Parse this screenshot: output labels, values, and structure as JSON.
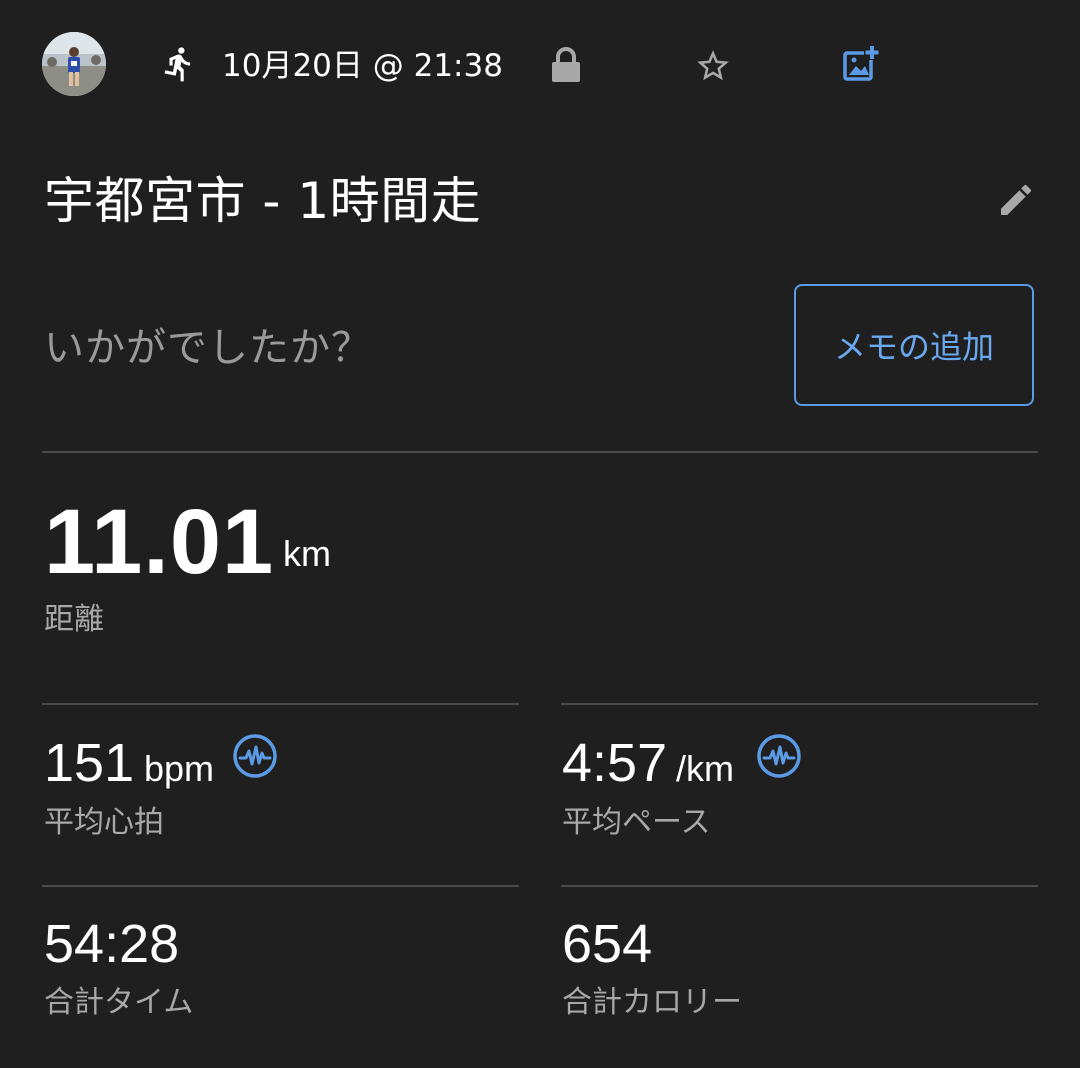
{
  "header": {
    "activity_icon": "running-icon",
    "datetime": "10月20日 @ 21:38",
    "privacy_icon": "lock-icon",
    "favorite_icon": "star-outline-icon",
    "add_photo_icon": "add-photo-icon"
  },
  "activity": {
    "title": "宇都宮市 - 1時間走",
    "edit_icon": "pencil-icon"
  },
  "note": {
    "prompt": "いかがでしたか？",
    "add_button_label": "メモの追加"
  },
  "distance": {
    "value": "11.01",
    "unit": "km",
    "label": "距離"
  },
  "stats": {
    "avg_heart_rate": {
      "value": "151",
      "unit": "bpm",
      "label": "平均心拍",
      "icon": "activity-pulse-icon"
    },
    "avg_pace": {
      "value": "4:57",
      "unit": "/km",
      "label": "平均ペース",
      "icon": "activity-pulse-icon"
    },
    "total_time": {
      "value": "54:28",
      "label": "合計タイム"
    },
    "total_calories": {
      "value": "654",
      "label": "合計カロリー"
    }
  },
  "colors": {
    "background": "#1f1f1f",
    "accent": "#5b9be6",
    "text_primary": "#ffffff",
    "text_secondary": "#a8a8a8"
  }
}
